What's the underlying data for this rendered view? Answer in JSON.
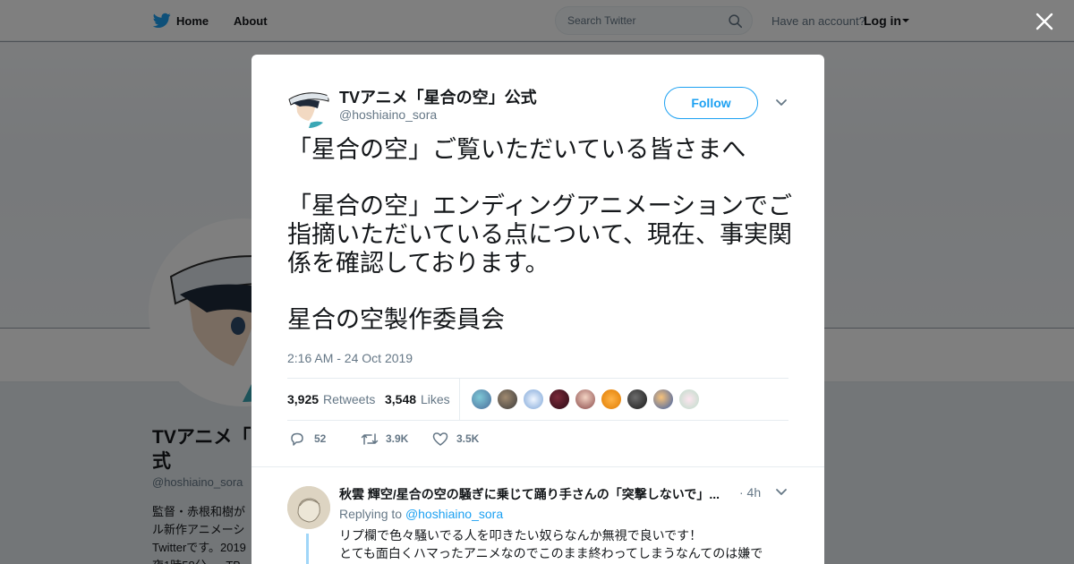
{
  "topbar": {
    "home_label": "Home",
    "about_label": "About",
    "search_placeholder": "Search Twitter",
    "have_account": "Have an account?",
    "login_label": "Log in"
  },
  "profile": {
    "name": "TVアニメ「\n式",
    "handle": "@hoshiaino_sora",
    "bio": "監督・赤根和樹が\nル新作アニメーシ\nTwitterです。2019\n夜1時58分..... TB"
  },
  "tweet": {
    "author_name": "TVアニメ「星合の空」公式",
    "author_handle": "@hoshiaino_sora",
    "follow_label": "Follow",
    "paragraphs": [
      "「星合の空」ご覧いただいている皆さまへ",
      "「星合の空」エンディングアニメーションでご指摘いただいている点について、現在、事実関係を確認しております。",
      "星合の空製作委員会"
    ],
    "timestamp": "2:16 AM - 24 Oct 2019",
    "retweets_count": "3,925",
    "retweets_label": "Retweets",
    "likes_count": "3,548",
    "likes_label": "Likes",
    "actions": {
      "replies": "52",
      "retweets": "3.9K",
      "likes": "3.5K"
    }
  },
  "reply": {
    "author_name": "秋雲 輝空/星合の空の騒ぎに乗じて踊り手さんの「突撃しないで」...",
    "time": "· 4h",
    "replying_to_prefix": "Replying to",
    "replying_to_handle": "@hoshiaino_sora",
    "text": "リプ欄で色々騒いでる人を叩きたい奴らなんか無視で良いです！\nとても面白くハマったアニメなのでこのまま終わってしまうなんてのは嫌で"
  },
  "colors": {
    "accent": "#1da1f2",
    "text_primary": "#14171a",
    "text_secondary": "#657786",
    "overlay": "rgba(0,0,0,0.5)"
  },
  "icons": [
    "twitter-bird-icon",
    "search-icon",
    "close-icon",
    "chevron-down-icon",
    "reply-icon",
    "retweet-icon",
    "heart-icon"
  ]
}
